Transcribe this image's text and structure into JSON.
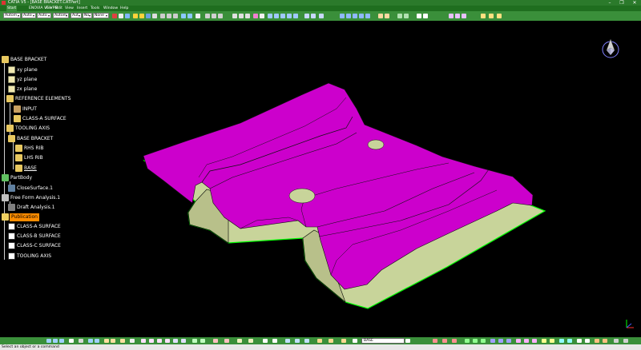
{
  "titlebar": {
    "title": "CATIA V5 - [BASE BRACKET.CATPart]",
    "minimize": "–",
    "maximize": "❐",
    "close": "✕"
  },
  "menubar": {
    "items": [
      "Start",
      "ENOVIA V5 VPM",
      "File",
      "Edit",
      "View",
      "Insert",
      "Tools",
      "Window",
      "Help"
    ]
  },
  "toolbar": {
    "combos": [
      "Autom",
      "Auto",
      "Auto",
      "Autom",
      "Aut",
      "No",
      "None"
    ]
  },
  "tree": {
    "root": "BASE BRACKET",
    "xy_plane": "xy plane",
    "yz_plane": "yz plane",
    "zx_plane": "zx plane",
    "reference_elements": "REFERENCE ELEMENTS",
    "input": "INPUT",
    "class_a_surface": "CLASS-A SURFACE",
    "tooling_axis": "TOOLING AXIS",
    "base_bracket": "BASE BRACKET",
    "rhs_rib": "RHS RIB",
    "lhs_rib": "LHS RIB",
    "base": "BASE",
    "partbody": "PartBody",
    "close_surface": "CloseSurface.1",
    "free_form": "Free Form Analysis.1",
    "draft_analysis": "Draft Analysis.1",
    "publication": "Publication",
    "pub_class_a": "CLASS-A SURFACE",
    "pub_class_b": "CLASS-B SURFACE",
    "pub_class_c": "CLASS-C SURFACE",
    "pub_tooling": "TOOLING AXIS"
  },
  "search": {
    "value": "BASE"
  },
  "status": {
    "text": "Select an object or a command"
  },
  "colors": {
    "magenta": "#cc00cc",
    "green_edge": "#00ff00",
    "tan_surface": "#c8d49a",
    "publication_highlight": "#ff8c00"
  }
}
